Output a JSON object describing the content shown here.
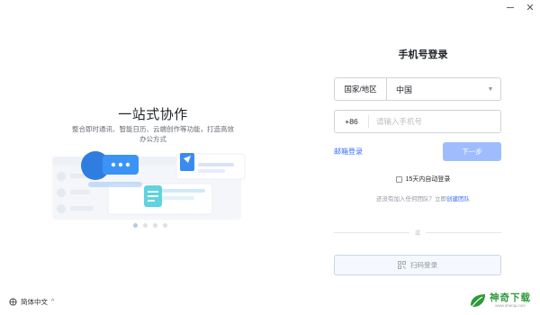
{
  "window": {
    "minimize_icon": "minimize-icon",
    "close_icon": "close-icon",
    "close_glyph": "✕"
  },
  "intro": {
    "title": "一站式协作",
    "subtitle": "整合即时通讯、智能日历、云端创作等功能，打造高效办公方式",
    "pager": {
      "count": 4,
      "active": 1
    }
  },
  "language": {
    "label": "简体中文",
    "icon": "globe-icon",
    "caret": "^"
  },
  "login": {
    "title": "手机号登录",
    "country_label": "国家/地区",
    "country_value": "中国",
    "country_caret": "▼",
    "dial_code": "+86",
    "phone_placeholder": "请输入手机号",
    "phone_value": "",
    "email_login": "邮箱登录",
    "next_button": "下一步",
    "auto_login": "15天内自动登录",
    "team_prompt": "还没有加入任何团队？立即",
    "create_team": "创建团队",
    "divider_text": "或",
    "qr_login": "扫码登录"
  },
  "watermark": {
    "title": "神奇下载",
    "url": "www.shenqi.com"
  },
  "colors": {
    "accent": "#3370ff",
    "button_disabled": "#9fbdfc",
    "text_primary": "#1f2329",
    "text_secondary": "#646a73",
    "border": "#d0d3d6",
    "watermark_green": "#2e9a3a"
  }
}
